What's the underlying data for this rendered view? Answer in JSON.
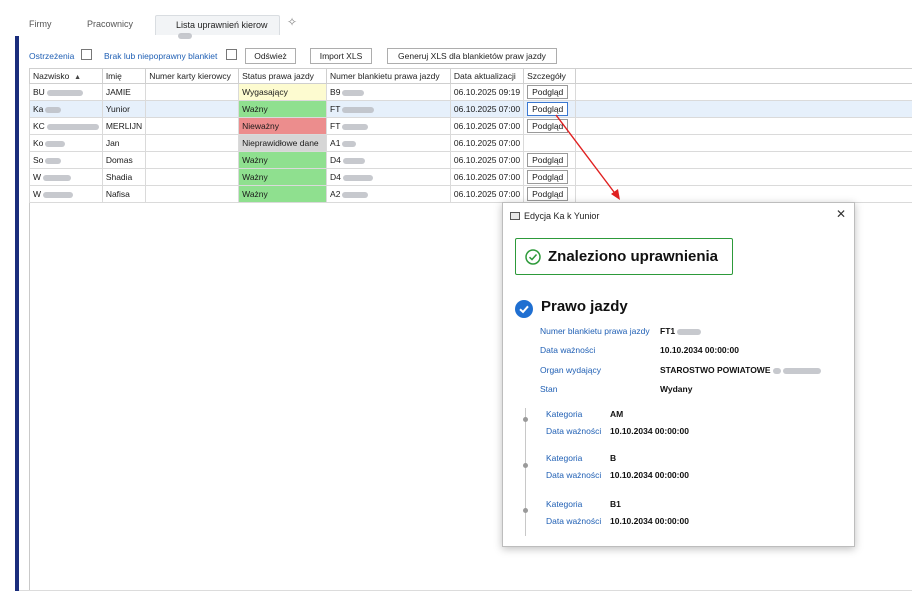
{
  "tabs": {
    "firmy": "Firmy",
    "pracownicy": "Pracownicy",
    "active": "Lista uprawnień kierow",
    "plus": "✧"
  },
  "toolbar": {
    "ostrzezenia": "Ostrzeżenia",
    "brak": "Brak lub niepoprawny blankiet",
    "odswiez": "Odśwież",
    "import": "Import XLS",
    "generuj": "Generuj XLS dla blankietów praw jazdy"
  },
  "grid": {
    "headers": [
      "Nazwisko",
      "Imię",
      "Numer karty kierowcy",
      "Status prawa jazdy",
      "Numer blankietu prawa jazdy",
      "Data aktualizacji",
      "Szczegóły"
    ],
    "sort_indicator": "▲",
    "rows": [
      {
        "last": "BU",
        "first": "JAMIE",
        "card": "",
        "status": "Wygasający",
        "status_color": "#fdfbd0",
        "blankiet": "B9",
        "date": "06.10.2025 09:19",
        "details": "Podgląd"
      },
      {
        "last": "Ka",
        "first": "Yunior",
        "card": "",
        "status": "Ważny",
        "status_color": "#8fe08f",
        "blankiet": "FT",
        "date": "06.10.2025 07:00",
        "details": "Podgląd"
      },
      {
        "last": "KC",
        "first": "MERLIJN",
        "card": "",
        "status": "Nieważny",
        "status_color": "#ec8d8d",
        "blankiet": "FT",
        "date": "06.10.2025 07:00",
        "details": "Podgląd"
      },
      {
        "last": "Ko",
        "first": "Jan",
        "card": "",
        "status": "Nieprawidłowe dane",
        "status_color": "#d6d6d6",
        "blankiet": "A1",
        "date": "06.10.2025 07:00",
        "details": ""
      },
      {
        "last": "So",
        "first": "Domas",
        "card": "",
        "status": "Ważny",
        "status_color": "#8fe08f",
        "blankiet": "D4",
        "date": "06.10.2025 07:00",
        "details": "Podgląd"
      },
      {
        "last": "W",
        "first": "Shadia",
        "card": "",
        "status": "Ważny",
        "status_color": "#8fe08f",
        "blankiet": "D4",
        "date": "06.10.2025 07:00",
        "details": "Podgląd"
      },
      {
        "last": "W",
        "first": "Nafisa",
        "card": "",
        "status": "Ważny",
        "status_color": "#8fe08f",
        "blankiet": "A2",
        "date": "06.10.2025 07:00",
        "details": "Podgląd"
      }
    ]
  },
  "dialog": {
    "title": "Edycja Ka    k Yunior",
    "close": "✕",
    "found": "Znaleziono uprawnienia",
    "section": "Prawo jazdy",
    "fields": [
      {
        "key": "Numer blankietu prawa jazdy",
        "value": "FT1"
      },
      {
        "key": "Data ważności",
        "value": "10.10.2034 00:00:00"
      },
      {
        "key": "Organ wydający",
        "value": "STAROSTWO POWIATOWE"
      },
      {
        "key": "Stan",
        "value": "Wydany"
      }
    ],
    "categories": [
      {
        "k1": "Kategoria",
        "v1": "AM",
        "k2": "Data ważności",
        "v2": "10.10.2034 00:00:00"
      },
      {
        "k1": "Kategoria",
        "v1": "B",
        "k2": "Data ważności",
        "v2": "10.10.2034 00:00:00"
      },
      {
        "k1": "Kategoria",
        "v1": "B1",
        "k2": "Data ważności",
        "v2": "10.10.2034 00:00:00"
      }
    ]
  },
  "colors": {
    "accent_bar": "#1a2d7c",
    "success_border": "#2d9a3a",
    "check_blue": "#1f6fd1",
    "arrow": "#e02020",
    "link": "#1f5fb4"
  }
}
